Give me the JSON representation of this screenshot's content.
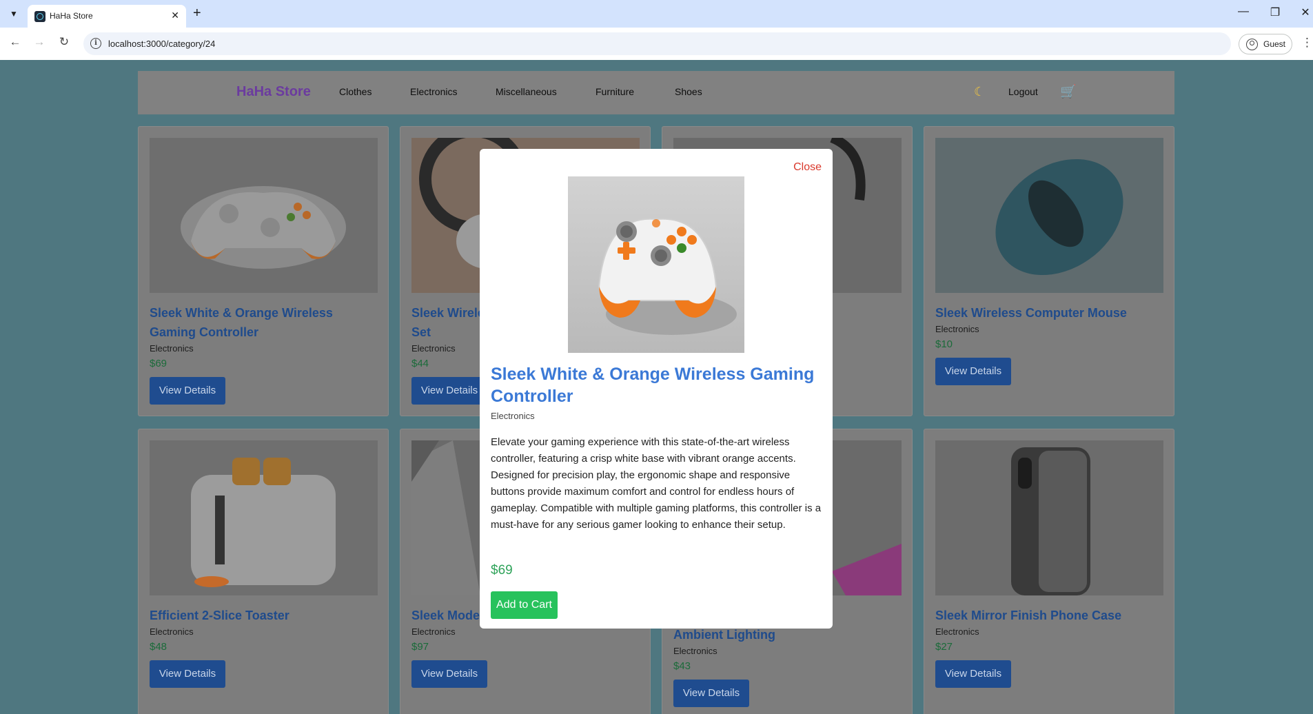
{
  "browser": {
    "tab_title": "HaHa Store",
    "url": "localhost:3000/category/24",
    "profile_label": "Guest"
  },
  "navbar": {
    "brand": "HaHa Store",
    "links": [
      "Clothes",
      "Electronics",
      "Miscellaneous",
      "Furniture",
      "Shoes"
    ],
    "logout": "Logout"
  },
  "products": [
    {
      "title": "Sleek White & Orange Wireless Gaming Controller",
      "category": "Electronics",
      "price": "$69",
      "button": "View Details"
    },
    {
      "title": "Sleek Wireless Headphone & Earbud Set",
      "category": "Electronics",
      "price": "$44",
      "button": "View Details"
    },
    {
      "title": "",
      "category": "",
      "price": "",
      "button": ""
    },
    {
      "title": "Sleek Wireless Computer Mouse",
      "category": "Electronics",
      "price": "$10",
      "button": "View Details"
    },
    {
      "title": "Efficient 2-Slice Toaster",
      "category": "Electronics",
      "price": "$48",
      "button": "View Details"
    },
    {
      "title": "Sleek Mode",
      "category": "Electronics",
      "price": "$97",
      "button": "View Details"
    },
    {
      "title": "Ambient Lighting",
      "category": "Electronics",
      "price": "$43",
      "button": "View Details"
    },
    {
      "title": "Sleek Mirror Finish Phone Case",
      "category": "Electronics",
      "price": "$27",
      "button": "View Details"
    }
  ],
  "modal": {
    "close_label": "Close",
    "title": "Sleek White & Orange Wireless Gaming Controller",
    "category": "Electronics",
    "description": "Elevate your gaming experience with this state-of-the-art wireless controller, featuring a crisp white base with vibrant orange accents. Designed for precision play, the ergonomic shape and responsive buttons provide maximum comfort and control for endless hours of gameplay. Compatible with multiple gaming platforms, this controller is a must-have for any serious gamer looking to enhance their setup.",
    "price": "$69",
    "add_to_cart": "Add to Cart"
  },
  "colors": {
    "page_bg": "#4f7780",
    "navbar_bg": "#818181",
    "brand": "#6b3b9f",
    "link_blue": "#3b79d6",
    "price_green": "#2fa35a",
    "add_to_cart": "#27c25c",
    "close_red": "#d9382b"
  },
  "icons": [
    "chevron-down-icon",
    "react-favicon-icon",
    "close-icon",
    "plus-icon",
    "back-icon",
    "forward-icon",
    "reload-icon",
    "info-icon",
    "guest-icon",
    "kebab-icon",
    "moon-icon",
    "cart-icon"
  ]
}
